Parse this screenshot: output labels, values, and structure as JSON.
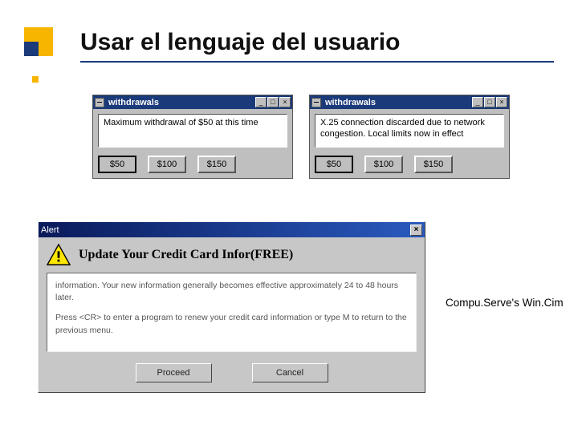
{
  "slide": {
    "title": "Usar el lenguaje del usuario"
  },
  "withdrawals_left": {
    "title": "withdrawals",
    "message": "Maximum withdrawal of $50 at this time",
    "buttons": {
      "b1": "$50",
      "b2": "$100",
      "b3": "$150"
    }
  },
  "withdrawals_right": {
    "title": "withdrawals",
    "message": "X.25 connection discarded due to network congestion. Local limits now in effect",
    "buttons": {
      "b1": "$50",
      "b2": "$100",
      "b3": "$150"
    }
  },
  "alert": {
    "title": "Alert",
    "close": "×",
    "heading": "Update Your Credit Card Infor(FREE)",
    "para1": "information. Your new information generally becomes effective approximately 24 to 48 hours later.",
    "para2": "Press <CR> to enter a program to renew your credit card information or type M to return to the previous menu.",
    "proceed": "Proceed",
    "cancel": "Cancel"
  },
  "caption": "Compu.Serve's Win.Cim"
}
